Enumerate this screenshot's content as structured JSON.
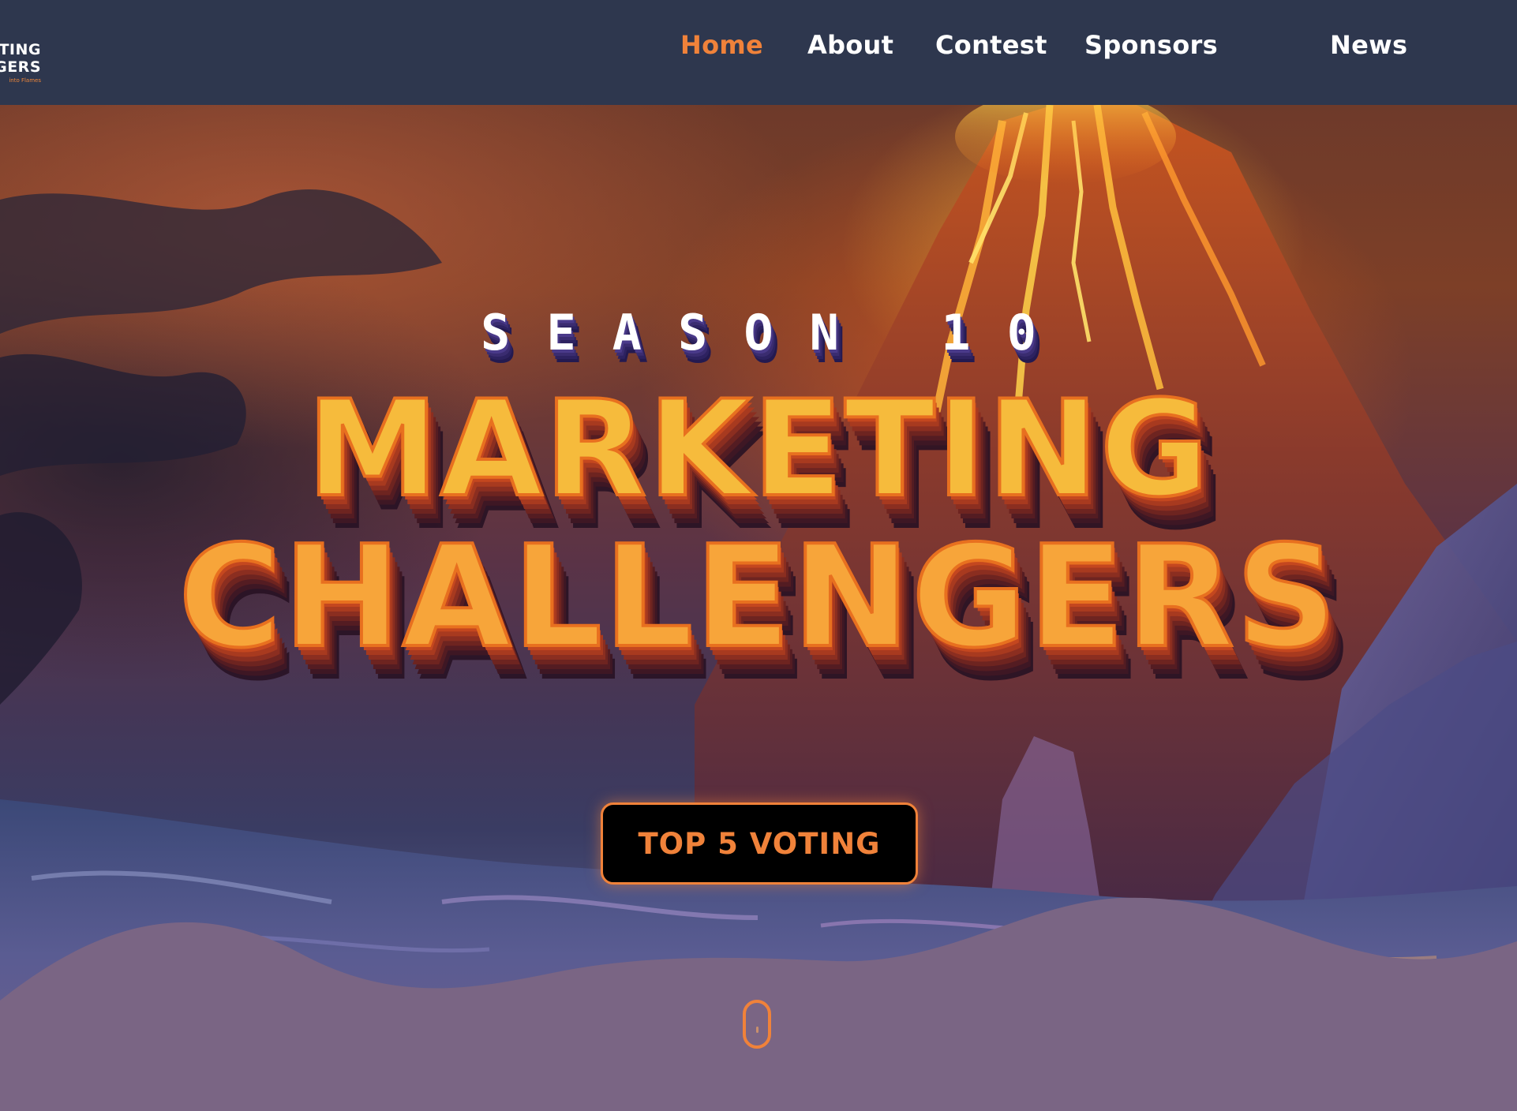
{
  "header": {
    "logo": {
      "line1": "TING",
      "line2": "GERS",
      "tagline": "into Flames"
    },
    "nav": [
      {
        "label": "Home",
        "active": true
      },
      {
        "label": "About",
        "active": false
      },
      {
        "label": "Contest",
        "active": false
      },
      {
        "label": "Sponsors",
        "active": false
      },
      {
        "label": "News",
        "active": false
      }
    ]
  },
  "hero": {
    "season": "SEASON 10",
    "title_line1": "MARKETING",
    "title_line2": "CHALLENGERS",
    "cta_label": "TOP 5 VOTING",
    "scroll_icon": "mouse-scroll-icon"
  },
  "colors": {
    "header_bg": "#2e374e",
    "accent": "#f0823a",
    "nav_text": "#ffffff",
    "button_bg": "#000000",
    "wave": "#7a6584"
  }
}
